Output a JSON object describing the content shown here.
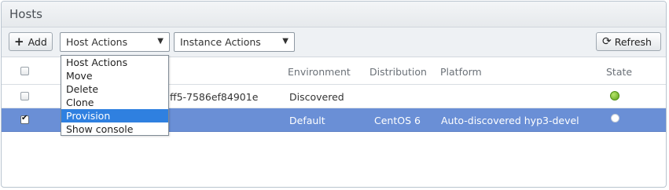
{
  "panel": {
    "title": "Hosts"
  },
  "toolbar": {
    "add_label": "Add",
    "host_actions_label": "Host Actions",
    "instance_actions_label": "Instance Actions",
    "refresh_label": "Refresh"
  },
  "table": {
    "columns": [
      "",
      "Environment",
      "Distribution",
      "Platform",
      "State"
    ],
    "rows": [
      {
        "name_fragment": "9ff5-7586ef84901e",
        "environment": "Discovered",
        "distribution": "",
        "platform": "",
        "state": "green",
        "checked": false,
        "selected": false
      },
      {
        "name_fragment": "",
        "environment": "Default",
        "distribution": "CentOS 6",
        "platform": "Auto-discovered hyp3-devel",
        "state": "white",
        "checked": true,
        "selected": true
      }
    ]
  },
  "dropdown": {
    "items": [
      {
        "label": "Host Actions"
      },
      {
        "label": "Move"
      },
      {
        "label": "Delete"
      },
      {
        "label": "Clone"
      },
      {
        "label": "Provision",
        "active": true
      },
      {
        "label": "Show console"
      }
    ]
  },
  "icons": {
    "add": "plus-icon",
    "select_caret": "caret-down-icon",
    "refresh": "refresh-icon",
    "checkbox": "checkbox-icon",
    "state_green": "status-green-dot-icon",
    "state_white": "status-white-dot-icon"
  },
  "colors": {
    "selected_row": "#6a8fd6",
    "menu_highlight": "#2f80e0",
    "state_green": "#6aae20"
  }
}
